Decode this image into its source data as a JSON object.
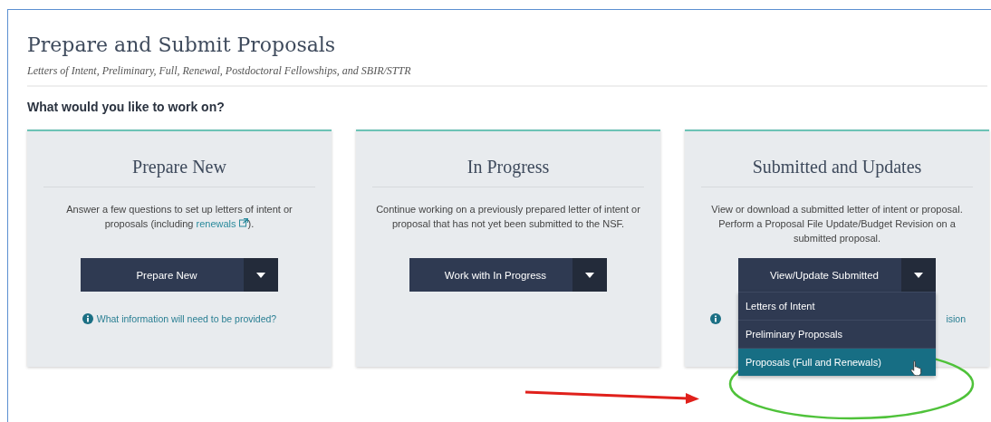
{
  "page": {
    "title": "Prepare and Submit Proposals",
    "subtitle": "Letters of Intent, Preliminary, Full, Renewal, Postdoctoral Fellowships, and SBIR/STTR",
    "question": "What would you like to work on?"
  },
  "cards": [
    {
      "title": "Prepare New",
      "description": "Answer a few questions to set up letters of intent or proposals (including ",
      "link": "renewals",
      "description_after": ").",
      "button": "Prepare New",
      "info": {
        "kind": "full",
        "text": "What information will need to be provided?"
      }
    },
    {
      "title": "In Progress",
      "description": "Continue working on a previously prepared letter of intent or proposal that has not yet been submitted to the NSF.",
      "button": "Work with In Progress"
    },
    {
      "title": "Submitted and Updates",
      "description": "View or download a submitted letter of intent or proposal. Perform a Proposal File Update/Budget Revision on a submitted proposal.",
      "button": "View/Update Submitted",
      "info": {
        "kind": "covered",
        "text": "ision"
      },
      "menu": [
        {
          "label": "Letters of Intent",
          "selected": false
        },
        {
          "label": "Preliminary Proposals",
          "selected": false
        },
        {
          "label": "Proposals (Full and Renewals)",
          "selected": true
        }
      ]
    }
  ]
}
